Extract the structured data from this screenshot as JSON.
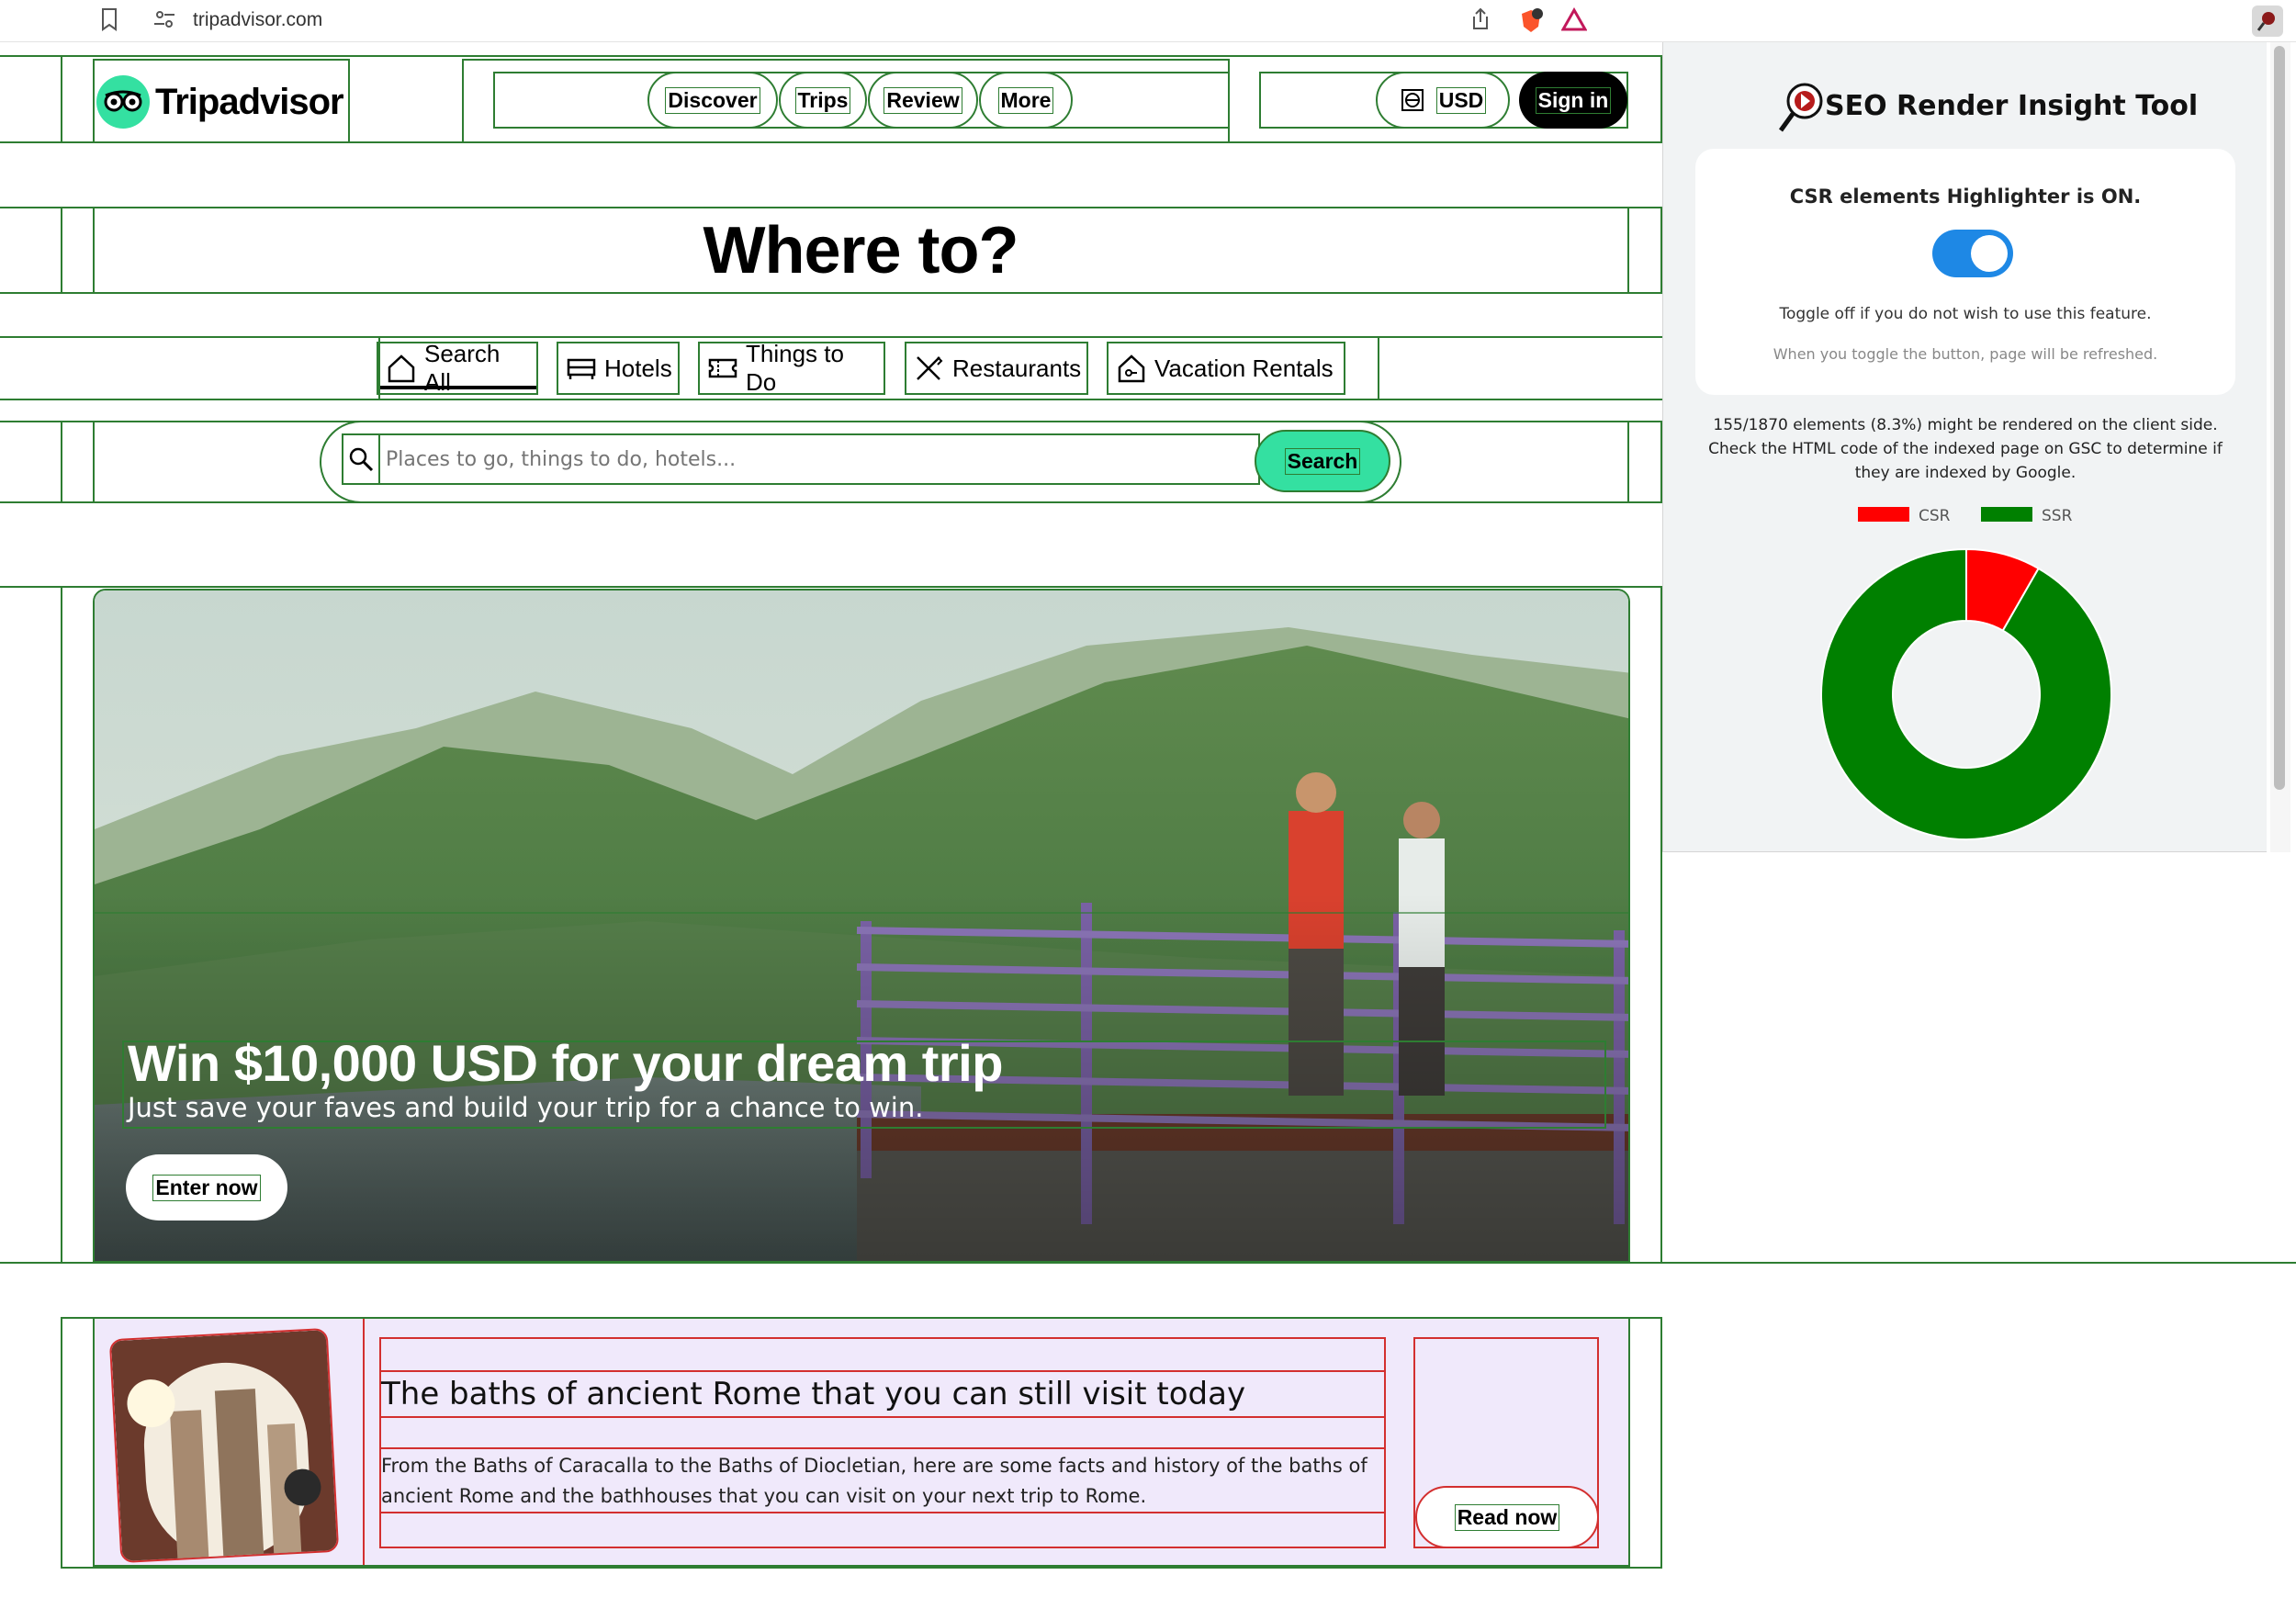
{
  "browser": {
    "url": "tripadvisor.com"
  },
  "header": {
    "logo_text": "Tripadvisor",
    "nav": [
      "Discover",
      "Trips",
      "Review",
      "More"
    ],
    "currency": "USD",
    "sign_in": "Sign in"
  },
  "hero_heading": "Where to?",
  "search_tabs": [
    "Search All",
    "Hotels",
    "Things to Do",
    "Restaurants",
    "Vacation Rentals"
  ],
  "search": {
    "placeholder": "Places to go, things to do, hotels...",
    "button": "Search"
  },
  "promo": {
    "title": "Win $10,000 USD for your dream trip",
    "subtitle": "Just save your faves and build your trip for a chance to win.",
    "button": "Enter now"
  },
  "article": {
    "title": "The baths of ancient Rome that you can still visit today",
    "description": "From the Baths of Caracalla to the Baths of Diocletian, here are some facts and history of the baths of ancient Rome and the bathhouses that you can visit on your next trip to Rome.",
    "button": "Read now"
  },
  "extension": {
    "title": "SEO Render Insight Tool",
    "status": "CSR elements Highlighter is ON.",
    "toggle_on": true,
    "hint": "Toggle off if you do not wish to use this feature.",
    "note": "When you toggle the button, page will be refreshed.",
    "summary": "155/1870 elements (8.3%) might be rendered on the client side. Check the HTML code of the indexed page on GSC to determine if they are indexed by Google.",
    "colors": {
      "csr": "#ff0000",
      "ssr": "#008000",
      "toggle": "#1e88e5"
    },
    "chart_data": {
      "type": "pie",
      "categories": [
        "CSR",
        "SSR"
      ],
      "values": [
        155,
        1715
      ],
      "legend": "top"
    }
  }
}
